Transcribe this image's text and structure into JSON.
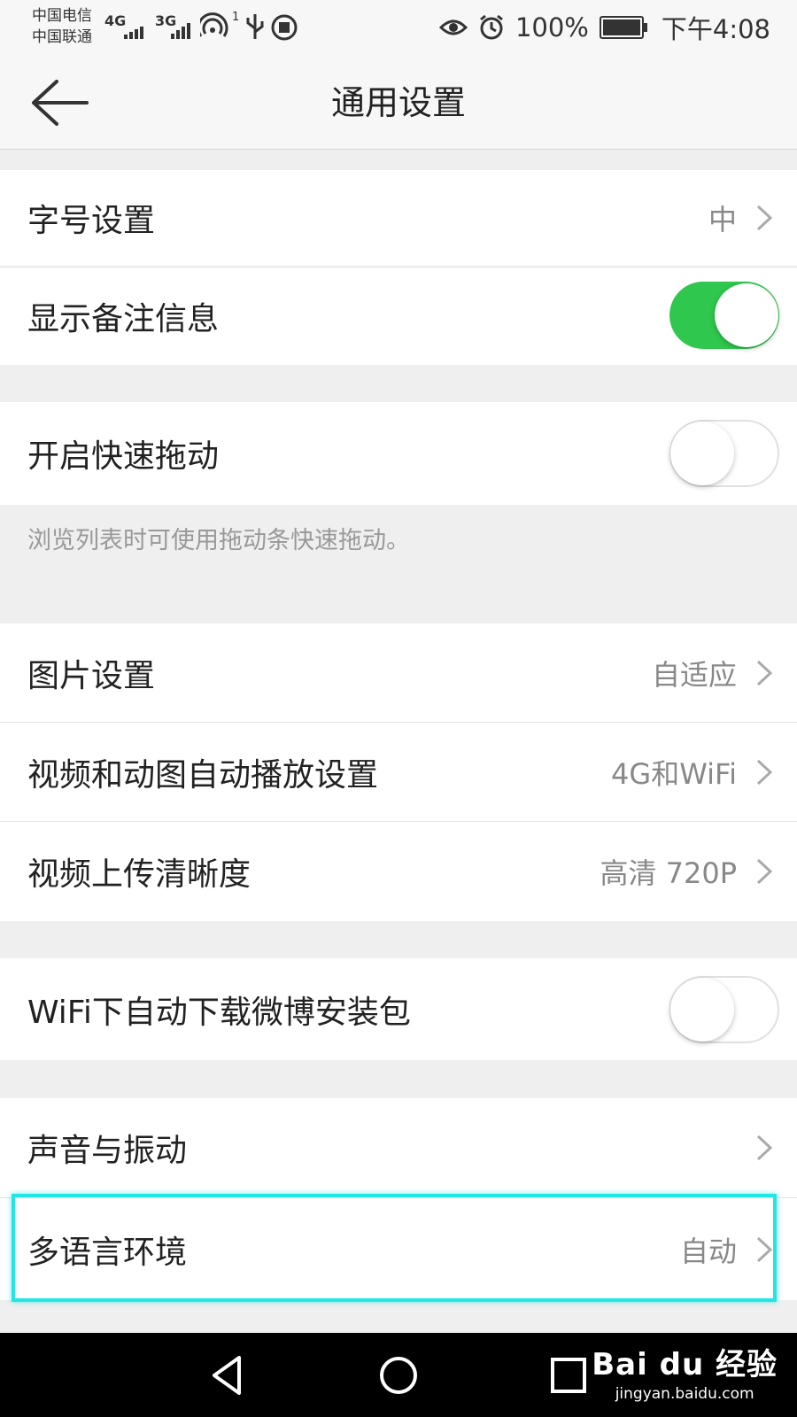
{
  "status_bar": {
    "carrier_1": "中国电信",
    "carrier_2": "中国联通",
    "net_1": "4G",
    "net_2": "3G",
    "hotspot_badge": "1",
    "battery": "100%",
    "time": "下午4:08"
  },
  "header": {
    "title": "通用设置",
    "back_icon": "arrow-left-icon"
  },
  "settings": {
    "font_size": {
      "label": "字号设置",
      "value": "中"
    },
    "show_remark": {
      "label": "显示备注信息",
      "toggle_on": true
    },
    "fast_drag": {
      "label": "开启快速拖动",
      "toggle_on": false,
      "hint": "浏览列表时可使用拖动条快速拖动。"
    },
    "image_settings": {
      "label": "图片设置",
      "value": "自适应"
    },
    "autoplay": {
      "label": "视频和动图自动播放设置",
      "value": "4G和WiFi"
    },
    "upload_quality": {
      "label": "视频上传清晰度",
      "value": "高清 720P"
    },
    "wifi_download": {
      "label": "WiFi下自动下载微博安装包",
      "toggle_on": false
    },
    "sound": {
      "label": "声音与振动",
      "value": ""
    },
    "language": {
      "label": "多语言环境",
      "value": "自动"
    }
  },
  "colors": {
    "toggle_on": "#2fc74d",
    "highlight": "#22e6e6"
  },
  "watermark": {
    "brand": "Bai du 经验",
    "url": "jingyan.baidu.com"
  }
}
